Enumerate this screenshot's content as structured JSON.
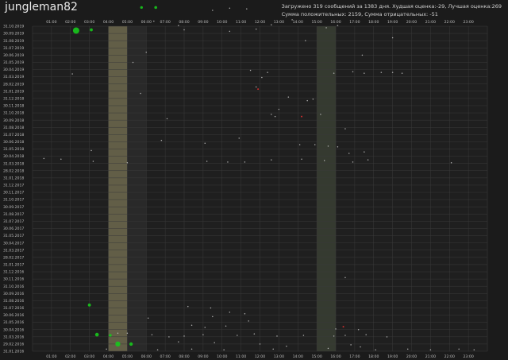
{
  "header": {
    "username": "jungleman82",
    "stats_line1": "Загружено 319 сообщений за 1383 дня. Худшая оценка:-29, Лучшая оценка:269",
    "stats_line2": "Сумма положительных: 2159, Сумма отрицательных: -51"
  },
  "colors": {
    "background": "#1b1b1b",
    "grid": "#3a3a3a",
    "highlight_band": "#6f6a4f",
    "second_band": "#3d4437",
    "point_positive": "#17c91c",
    "point_neutral": "#bdbdbd",
    "point_negative": "#e03030"
  },
  "chart_data": {
    "type": "scatter",
    "title": "",
    "x_axis": {
      "label": "",
      "ticks": [
        "01:00",
        "02:00",
        "03:00",
        "04:00",
        "05:00",
        "06:00",
        "07:00",
        "08:00",
        "09:00",
        "10:00",
        "11:00",
        "12:00",
        "13:00",
        "14:00",
        "15:00",
        "16:00",
        "17:00",
        "18:00",
        "19:00",
        "20:00",
        "21:00",
        "22:00",
        "23:00"
      ],
      "range": [
        "00:00",
        "24:00"
      ]
    },
    "y_axis": {
      "label": "",
      "ticks": [
        "31.10.2019",
        "30.09.2019",
        "31.08.2019",
        "31.07.2019",
        "30.06.2019",
        "31.05.2019",
        "30.04.2019",
        "31.03.2019",
        "28.02.2019",
        "31.01.2019",
        "31.12.2018",
        "30.11.2018",
        "31.10.2018",
        "30.09.2018",
        "31.08.2018",
        "31.07.2018",
        "30.06.2018",
        "31.05.2018",
        "30.04.2018",
        "31.03.2018",
        "28.02.2018",
        "31.01.2018",
        "31.12.2017",
        "30.11.2017",
        "31.10.2017",
        "30.09.2017",
        "31.08.2017",
        "31.07.2017",
        "30.06.2017",
        "31.05.2017",
        "30.04.2017",
        "31.03.2017",
        "28.02.2017",
        "31.01.2017",
        "31.12.2016",
        "30.11.2016",
        "31.10.2016",
        "30.09.2016",
        "31.08.2016",
        "31.07.2016",
        "30.06.2016",
        "31.05.2016",
        "30.04.2016",
        "31.03.2016",
        "29.02.2016",
        "31.01.2016"
      ],
      "range": [
        "31.01.2016",
        "31.10.2019"
      ]
    },
    "grid": true,
    "bands": [
      {
        "from_hour": 4.0,
        "to_hour": 5.0,
        "tone": "highlight"
      },
      {
        "from_hour": 5.0,
        "to_hour": 6.0,
        "tone": "dark"
      },
      {
        "from_hour": 15.0,
        "to_hour": 16.0,
        "tone": "second"
      }
    ],
    "points": [
      {
        "hour": 2.3,
        "month": 44.4,
        "score": 60
      },
      {
        "hour": 3.1,
        "month": 44.5,
        "score": 5
      },
      {
        "hour": 5.75,
        "month": 47.6,
        "score": 3
      },
      {
        "hour": 6.5,
        "month": 47.6,
        "score": 4
      },
      {
        "hour": 9.5,
        "month": 47.2,
        "score": 1
      },
      {
        "hour": 10.4,
        "month": 47.5,
        "score": 1
      },
      {
        "hour": 11.3,
        "month": 47.4,
        "score": 2
      },
      {
        "hour": 6.4,
        "month": 45.7,
        "score": 1
      },
      {
        "hour": 7.7,
        "month": 45.1,
        "score": 1
      },
      {
        "hour": 8.0,
        "month": 44.5,
        "score": 1
      },
      {
        "hour": 10.4,
        "month": 44.3,
        "score": 1
      },
      {
        "hour": 11.8,
        "month": 44.6,
        "score": 1
      },
      {
        "hour": 12.6,
        "month": 45.2,
        "score": 1
      },
      {
        "hour": 15.5,
        "month": 44.8,
        "score": 1
      },
      {
        "hour": 13.7,
        "month": 45.9,
        "score": 1
      },
      {
        "hour": 16.1,
        "month": 45.1,
        "score": 1
      },
      {
        "hour": 19.0,
        "month": 43.4,
        "score": 1
      },
      {
        "hour": 14.4,
        "month": 43.0,
        "score": 1
      },
      {
        "hour": 17.4,
        "month": 41.0,
        "score": 1
      },
      {
        "hour": 6.0,
        "month": 41.4,
        "score": 1
      },
      {
        "hour": 5.3,
        "month": 40.0,
        "score": 1
      },
      {
        "hour": 2.1,
        "month": 38.4,
        "score": 1
      },
      {
        "hour": 11.5,
        "month": 38.9,
        "score": 1
      },
      {
        "hour": 12.4,
        "month": 38.6,
        "score": 1
      },
      {
        "hour": 15.9,
        "month": 38.5,
        "score": 1
      },
      {
        "hour": 16.9,
        "month": 38.7,
        "score": 1
      },
      {
        "hour": 17.5,
        "month": 38.5,
        "score": 1
      },
      {
        "hour": 18.4,
        "month": 38.6,
        "score": 1
      },
      {
        "hour": 19.0,
        "month": 38.6,
        "score": 1
      },
      {
        "hour": 19.5,
        "month": 38.5,
        "score": 1
      },
      {
        "hour": 12.1,
        "month": 37.9,
        "score": 1
      },
      {
        "hour": 11.8,
        "month": 36.6,
        "score": 1
      },
      {
        "hour": 11.9,
        "month": 36.3,
        "score": -2
      },
      {
        "hour": 5.7,
        "month": 35.7,
        "score": 1
      },
      {
        "hour": 13.5,
        "month": 35.2,
        "score": 1
      },
      {
        "hour": 14.5,
        "month": 34.7,
        "score": 1
      },
      {
        "hour": 14.8,
        "month": 34.9,
        "score": 1
      },
      {
        "hour": 13.0,
        "month": 33.5,
        "score": 1
      },
      {
        "hour": 12.6,
        "month": 32.8,
        "score": 1
      },
      {
        "hour": 14.2,
        "month": 32.5,
        "score": -2
      },
      {
        "hour": 15.2,
        "month": 32.8,
        "score": 1
      },
      {
        "hour": 7.1,
        "month": 32.2,
        "score": 1
      },
      {
        "hour": 12.8,
        "month": 32.5,
        "score": 1
      },
      {
        "hour": 16.5,
        "month": 30.8,
        "score": 1
      },
      {
        "hour": 6.8,
        "month": 29.2,
        "score": 1
      },
      {
        "hour": 10.9,
        "month": 29.5,
        "score": 1
      },
      {
        "hour": 14.1,
        "month": 28.6,
        "score": 1
      },
      {
        "hour": 14.9,
        "month": 28.6,
        "score": 1
      },
      {
        "hour": 15.6,
        "month": 28.4,
        "score": 1
      },
      {
        "hour": 16.1,
        "month": 28.3,
        "score": 1
      },
      {
        "hour": 16.7,
        "month": 27.4,
        "score": 1
      },
      {
        "hour": 3.1,
        "month": 27.8,
        "score": 1
      },
      {
        "hour": 9.1,
        "month": 28.8,
        "score": 1
      },
      {
        "hour": 17.5,
        "month": 27.6,
        "score": 1
      },
      {
        "hour": 0.6,
        "month": 26.7,
        "score": 1
      },
      {
        "hour": 1.5,
        "month": 26.6,
        "score": 1
      },
      {
        "hour": 3.2,
        "month": 26.3,
        "score": 1
      },
      {
        "hour": 5.0,
        "month": 26.1,
        "score": 1
      },
      {
        "hour": 9.2,
        "month": 26.3,
        "score": 1
      },
      {
        "hour": 10.3,
        "month": 26.2,
        "score": 1
      },
      {
        "hour": 11.2,
        "month": 26.2,
        "score": 1
      },
      {
        "hour": 12.6,
        "month": 26.5,
        "score": 1
      },
      {
        "hour": 14.2,
        "month": 26.6,
        "score": 1
      },
      {
        "hour": 15.4,
        "month": 26.4,
        "score": 1
      },
      {
        "hour": 16.9,
        "month": 26.2,
        "score": 1
      },
      {
        "hour": 17.7,
        "month": 26.5,
        "score": 1
      },
      {
        "hour": 22.1,
        "month": 26.1,
        "score": 1
      },
      {
        "hour": 16.5,
        "month": 10.2,
        "score": 1
      },
      {
        "hour": 3.0,
        "month": 6.4,
        "score": 5
      },
      {
        "hour": 8.2,
        "month": 6.2,
        "score": 1
      },
      {
        "hour": 9.4,
        "month": 6.0,
        "score": 1
      },
      {
        "hour": 10.4,
        "month": 5.4,
        "score": 1
      },
      {
        "hour": 11.2,
        "month": 5.2,
        "score": 1
      },
      {
        "hour": 6.1,
        "month": 4.6,
        "score": 1
      },
      {
        "hour": 9.5,
        "month": 4.8,
        "score": 1
      },
      {
        "hour": 11.4,
        "month": 4.2,
        "score": 1
      },
      {
        "hour": 8.4,
        "month": 3.6,
        "score": 1
      },
      {
        "hour": 9.1,
        "month": 3.3,
        "score": 1
      },
      {
        "hour": 10.2,
        "month": 3.5,
        "score": 1
      },
      {
        "hour": 16.4,
        "month": 3.4,
        "score": -3
      },
      {
        "hour": 16.0,
        "month": 3.1,
        "score": 1
      },
      {
        "hour": 17.2,
        "month": 3.0,
        "score": 1
      },
      {
        "hour": 3.4,
        "month": 2.3,
        "score": 10
      },
      {
        "hour": 4.1,
        "month": 2.2,
        "score": 4
      },
      {
        "hour": 4.5,
        "month": 2.5,
        "score": 1
      },
      {
        "hour": 5.0,
        "month": 2.5,
        "score": 1
      },
      {
        "hour": 6.3,
        "month": 2.3,
        "score": 1
      },
      {
        "hour": 7.2,
        "month": 2.0,
        "score": 1
      },
      {
        "hour": 8.0,
        "month": 2.1,
        "score": 1
      },
      {
        "hour": 9.0,
        "month": 2.3,
        "score": 1
      },
      {
        "hour": 10.8,
        "month": 2.2,
        "score": 1
      },
      {
        "hour": 11.7,
        "month": 2.4,
        "score": 1
      },
      {
        "hour": 12.9,
        "month": 2.1,
        "score": 1
      },
      {
        "hour": 14.3,
        "month": 2.2,
        "score": 1
      },
      {
        "hour": 15.9,
        "month": 2.1,
        "score": 1
      },
      {
        "hour": 16.5,
        "month": 2.2,
        "score": 1
      },
      {
        "hour": 17.6,
        "month": 2.3,
        "score": 1
      },
      {
        "hour": 18.7,
        "month": 2.0,
        "score": 1
      },
      {
        "hour": 4.5,
        "month": 1.0,
        "score": 25
      },
      {
        "hour": 5.2,
        "month": 1.0,
        "score": 8
      },
      {
        "hour": 7.7,
        "month": 1.3,
        "score": 1
      },
      {
        "hour": 9.6,
        "month": 1.2,
        "score": 1
      },
      {
        "hour": 12.0,
        "month": 1.0,
        "score": 1
      },
      {
        "hour": 13.4,
        "month": 0.7,
        "score": 1
      },
      {
        "hour": 16.8,
        "month": 0.9,
        "score": 1
      },
      {
        "hour": 17.3,
        "month": 0.6,
        "score": 2
      },
      {
        "hour": 3.9,
        "month": 0.3,
        "score": 1
      },
      {
        "hour": 6.6,
        "month": 0.2,
        "score": 1
      },
      {
        "hour": 8.4,
        "month": 0.3,
        "score": 1
      },
      {
        "hour": 10.1,
        "month": 0.2,
        "score": 1
      },
      {
        "hour": 12.7,
        "month": 0.3,
        "score": 1
      },
      {
        "hour": 15.6,
        "month": 0.4,
        "score": 1
      },
      {
        "hour": 18.1,
        "month": 0.2,
        "score": 1
      },
      {
        "hour": 19.8,
        "month": 0.3,
        "score": 1
      },
      {
        "hour": 21.0,
        "month": 0.2,
        "score": 1
      },
      {
        "hour": 22.5,
        "month": 0.3,
        "score": 1
      },
      {
        "hour": 23.3,
        "month": 0.2,
        "score": 1
      }
    ]
  }
}
